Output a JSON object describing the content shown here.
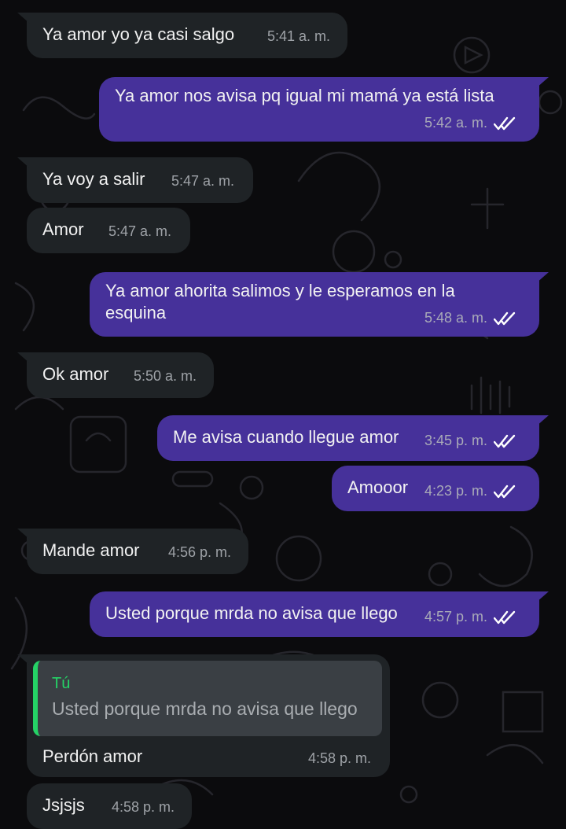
{
  "colors": {
    "background": "#0b0b0d",
    "incoming_bubble": "#1f2326",
    "outgoing_bubble": "#46319a",
    "read_ticks": "#ffffff",
    "quote_accent": "#25d366"
  },
  "messages": [
    {
      "direction": "in",
      "text": "Ya amor yo ya casi salgo",
      "time": "5:41 a. m."
    },
    {
      "direction": "out",
      "text": "Ya amor nos avisa pq igual mi mamá ya está lista",
      "time": "5:42 a. m.",
      "status": "read"
    },
    {
      "direction": "in",
      "text": "Ya voy a salir",
      "time": "5:47 a. m."
    },
    {
      "direction": "in",
      "text": "Amor",
      "time": "5:47 a. m."
    },
    {
      "direction": "out",
      "text": "Ya amor ahorita salimos y le esperamos en la esquina",
      "time": "5:48 a. m.",
      "status": "read"
    },
    {
      "direction": "in",
      "text": "Ok amor",
      "time": "5:50 a. m."
    },
    {
      "direction": "out",
      "text": "Me avisa cuando llegue amor",
      "time": "3:45 p. m.",
      "status": "read"
    },
    {
      "direction": "out",
      "text": "Amooor",
      "time": "4:23 p. m.",
      "status": "read"
    },
    {
      "direction": "in",
      "text": "Mande amor",
      "time": "4:56 p. m."
    },
    {
      "direction": "out",
      "text": "Usted porque mrda no avisa que llego",
      "time": "4:57 p. m.",
      "status": "read"
    },
    {
      "direction": "in",
      "text": "Perdón amor",
      "time": "4:58 p. m.",
      "quote": {
        "author": "Tú",
        "text": "Usted porque mrda no avisa que llego"
      }
    },
    {
      "direction": "in",
      "text": "Jsjsjs",
      "time": "4:58 p. m."
    }
  ]
}
